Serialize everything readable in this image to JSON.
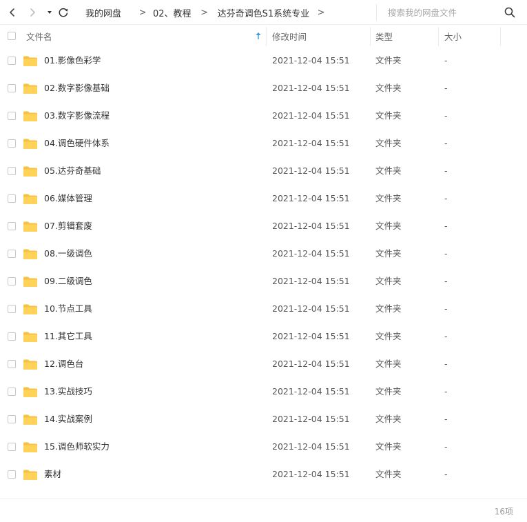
{
  "nav": {
    "back_icon": "chevron-left-icon",
    "forward_icon": "chevron-right-icon",
    "dropdown_icon": "caret-down-icon",
    "refresh_icon": "refresh-icon"
  },
  "breadcrumb": {
    "items": [
      "我的网盘",
      "02、教程",
      "达芬奇调色S1系统专业"
    ],
    "separator": ">"
  },
  "search": {
    "placeholder": "搜索我的网盘文件",
    "icon": "search-icon"
  },
  "columns": {
    "name": "文件名",
    "modified": "修改时间",
    "type": "类型",
    "size": "大小",
    "sort_icon": "sort-up-arrow-icon"
  },
  "files": [
    {
      "name": "01.影像色彩学",
      "modified": "2021-12-04 15:51",
      "type": "文件夹",
      "size": "-"
    },
    {
      "name": "02.数字影像基础",
      "modified": "2021-12-04 15:51",
      "type": "文件夹",
      "size": "-"
    },
    {
      "name": "03.数字影像流程",
      "modified": "2021-12-04 15:51",
      "type": "文件夹",
      "size": "-"
    },
    {
      "name": "04.调色硬件体系",
      "modified": "2021-12-04 15:51",
      "type": "文件夹",
      "size": "-"
    },
    {
      "name": "05.达芬奇基础",
      "modified": "2021-12-04 15:51",
      "type": "文件夹",
      "size": "-"
    },
    {
      "name": "06.媒体管理",
      "modified": "2021-12-04 15:51",
      "type": "文件夹",
      "size": "-"
    },
    {
      "name": "07.剪辑套废",
      "modified": "2021-12-04 15:51",
      "type": "文件夹",
      "size": "-"
    },
    {
      "name": "08.一级调色",
      "modified": "2021-12-04 15:51",
      "type": "文件夹",
      "size": "-"
    },
    {
      "name": "09.二级调色",
      "modified": "2021-12-04 15:51",
      "type": "文件夹",
      "size": "-"
    },
    {
      "name": "10.节点工具",
      "modified": "2021-12-04 15:51",
      "type": "文件夹",
      "size": "-"
    },
    {
      "name": "11.其它工具",
      "modified": "2021-12-04 15:51",
      "type": "文件夹",
      "size": "-"
    },
    {
      "name": "12.调色台",
      "modified": "2021-12-04 15:51",
      "type": "文件夹",
      "size": "-"
    },
    {
      "name": "13.实战技巧",
      "modified": "2021-12-04 15:51",
      "type": "文件夹",
      "size": "-"
    },
    {
      "name": "14.实战案例",
      "modified": "2021-12-04 15:51",
      "type": "文件夹",
      "size": "-"
    },
    {
      "name": "15.调色师软实力",
      "modified": "2021-12-04 15:51",
      "type": "文件夹",
      "size": "-"
    },
    {
      "name": "素材",
      "modified": "2021-12-04 15:51",
      "type": "文件夹",
      "size": "-"
    }
  ],
  "footer": {
    "count": "16项"
  },
  "colors": {
    "folder": "#FFD25A",
    "folder_tab": "#F5C242",
    "sort_arrow": "#3A9BD9"
  }
}
